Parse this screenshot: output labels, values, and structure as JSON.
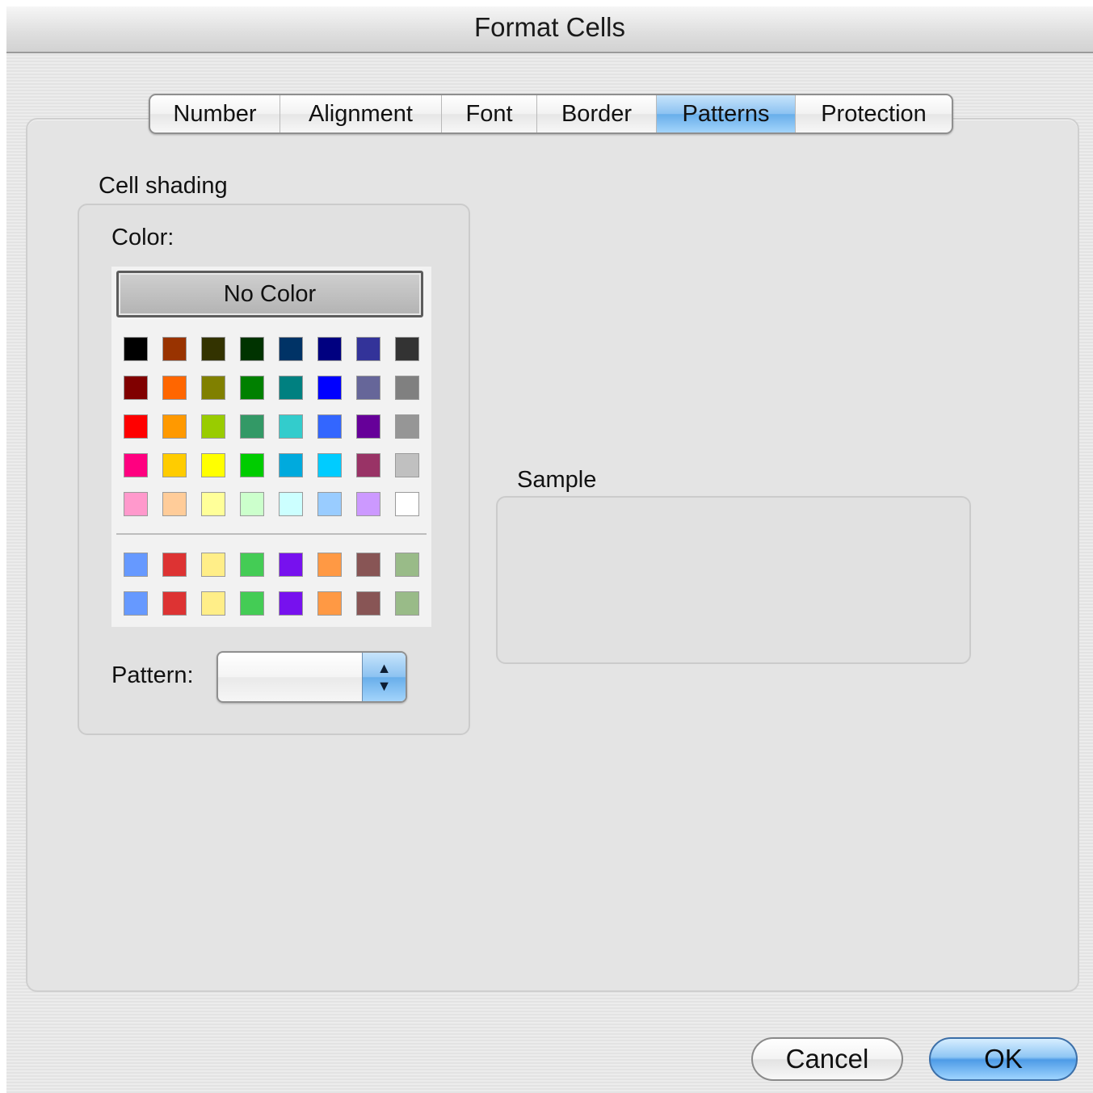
{
  "window": {
    "title": "Format Cells"
  },
  "tabs": [
    {
      "label": "Number",
      "active": false
    },
    {
      "label": "Alignment",
      "active": false
    },
    {
      "label": "Font",
      "active": false
    },
    {
      "label": "Border",
      "active": false
    },
    {
      "label": "Patterns",
      "active": true
    },
    {
      "label": "Protection",
      "active": false
    }
  ],
  "cell_shading": {
    "group_label": "Cell shading",
    "color_label": "Color:",
    "no_color_label": "No Color",
    "palette_rows": [
      [
        "#000000",
        "#993300",
        "#333300",
        "#003300",
        "#003366",
        "#000080",
        "#333399",
        "#333333"
      ],
      [
        "#800000",
        "#ff6600",
        "#808000",
        "#008000",
        "#008080",
        "#0000ff",
        "#666699",
        "#808080"
      ],
      [
        "#ff0000",
        "#ff9900",
        "#99cc00",
        "#339966",
        "#33cccc",
        "#3366ff",
        "#660099",
        "#969696"
      ],
      [
        "#ff0080",
        "#ffcc00",
        "#ffff00",
        "#00cc00",
        "#00aadd",
        "#00ccff",
        "#993366",
        "#c0c0c0"
      ],
      [
        "#ff99cc",
        "#ffcc99",
        "#ffff99",
        "#ccffcc",
        "#ccffff",
        "#99ccff",
        "#cc99ff",
        "#ffffff"
      ]
    ],
    "custom_rows": [
      [
        "#6699ff",
        "#dd3333",
        "#ffee88",
        "#44cc55",
        "#7711ee",
        "#ff9944",
        "#885555",
        "#99bb88"
      ],
      [
        "#6699ff",
        "#dd3333",
        "#ffee88",
        "#44cc55",
        "#7711ee",
        "#ff9944",
        "#885555",
        "#99bb88"
      ]
    ],
    "pattern_label": "Pattern:",
    "pattern_value": ""
  },
  "sample": {
    "label": "Sample"
  },
  "buttons": {
    "cancel": "Cancel",
    "ok": "OK"
  }
}
